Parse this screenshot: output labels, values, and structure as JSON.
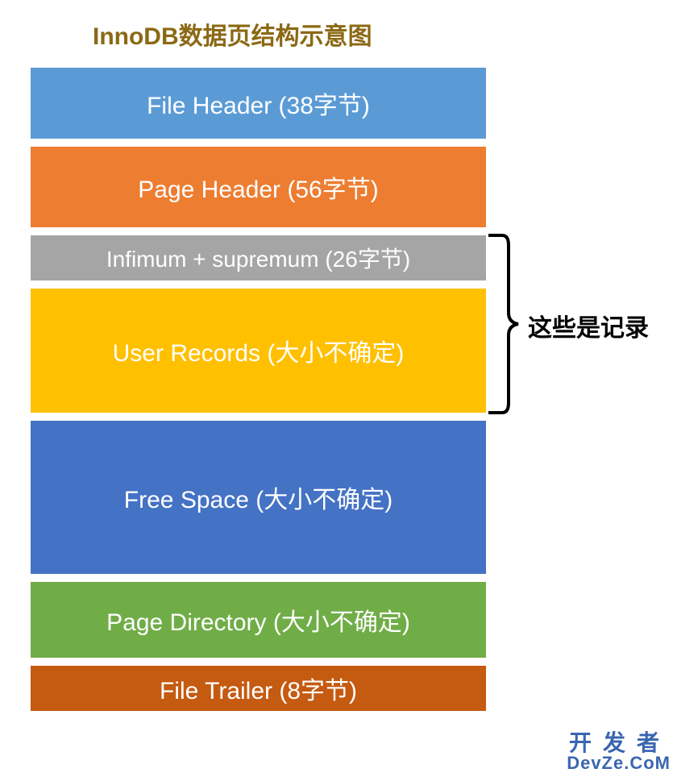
{
  "title": "InnoDB数据页结构示意图",
  "blocks": {
    "file_header": "File Header (38字节)",
    "page_header": "Page Header (56字节)",
    "infimum": "Infimum + supremum (26字节)",
    "user_records": "User Records (大小不确定)",
    "free_space": "Free Space (大小不确定)",
    "page_directory": "Page Directory (大小不确定)",
    "file_trailer": "File Trailer (8字节)"
  },
  "annotation": "这些是记录",
  "watermark": {
    "line1": "开发者",
    "line2": "DevZe.CoM"
  },
  "chart_data": {
    "type": "table",
    "title": "InnoDB数据页结构示意图",
    "sections": [
      {
        "name": "File Header",
        "size": "38字节"
      },
      {
        "name": "Page Header",
        "size": "56字节"
      },
      {
        "name": "Infimum + supremum",
        "size": "26字节",
        "group": "记录"
      },
      {
        "name": "User Records",
        "size": "大小不确定",
        "group": "记录"
      },
      {
        "name": "Free Space",
        "size": "大小不确定"
      },
      {
        "name": "Page Directory",
        "size": "大小不确定"
      },
      {
        "name": "File Trailer",
        "size": "8字节"
      }
    ],
    "annotation": {
      "label": "这些是记录",
      "covers": [
        "Infimum + supremum",
        "User Records"
      ]
    }
  }
}
